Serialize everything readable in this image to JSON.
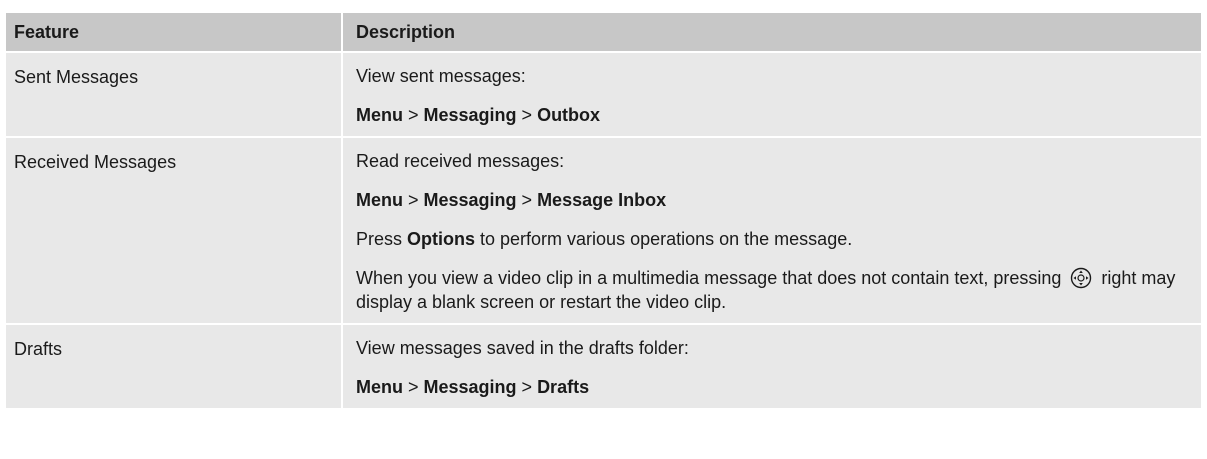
{
  "table": {
    "headers": {
      "feature": "Feature",
      "description": "Description"
    },
    "rows": [
      {
        "feature": "Sent Messages",
        "intro": "View sent messages:",
        "path": [
          "Menu",
          "Messaging",
          "Outbox"
        ],
        "separator": " > "
      },
      {
        "feature": "Received Messages",
        "intro": "Read received messages:",
        "path": [
          "Menu",
          "Messaging",
          "Message Inbox"
        ],
        "separator": " > ",
        "options_prefix": "Press ",
        "options_label": "Options",
        "options_suffix": " to perform various operations on the message.",
        "note_before_icon": "When you view a video clip in a multimedia message that does not contain text, pressing",
        "note_icon": "navigation-key-icon",
        "note_after_icon": "right may display a blank screen or restart the video clip."
      },
      {
        "feature": "Drafts",
        "intro": "View messages saved in the drafts folder:",
        "path": [
          "Menu",
          "Messaging",
          "Drafts"
        ],
        "separator": " > "
      }
    ]
  }
}
